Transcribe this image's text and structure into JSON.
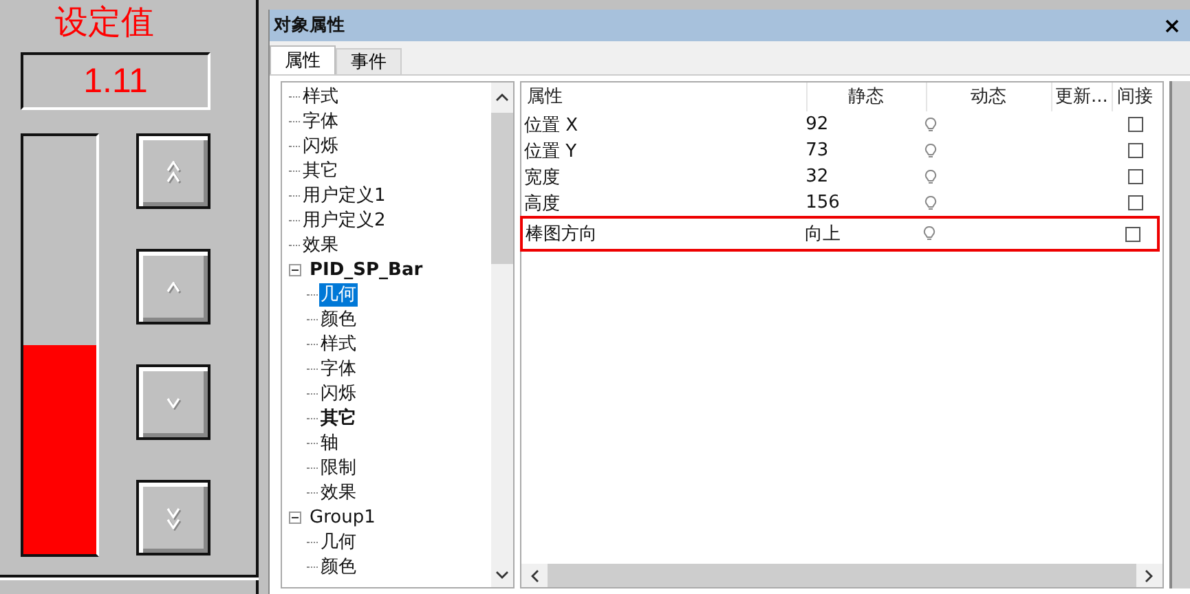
{
  "faceplate": {
    "title": "设定值",
    "value": "1.11",
    "bar": {
      "level": 0.5
    },
    "buttons": [
      {
        "kind": "fast-up"
      },
      {
        "kind": "up"
      },
      {
        "kind": "down"
      },
      {
        "kind": "fast-down"
      }
    ]
  },
  "window": {
    "title": "对象属性"
  },
  "tabs": [
    {
      "label": "属性",
      "selected": true
    },
    {
      "label": "事件",
      "selected": false
    }
  ],
  "tree": {
    "continued": [
      {
        "label": "样式",
        "bold": false,
        "selected": false
      },
      {
        "label": "字体",
        "bold": false,
        "selected": false
      },
      {
        "label": "闪烁",
        "bold": false,
        "selected": false
      },
      {
        "label": "其它",
        "bold": false,
        "selected": false
      },
      {
        "label": "用户定义1",
        "bold": false,
        "selected": false
      },
      {
        "label": "用户定义2",
        "bold": false,
        "selected": false
      },
      {
        "label": "效果",
        "bold": false,
        "selected": false
      }
    ],
    "nodes": [
      {
        "label": "PID_SP_Bar",
        "bold": true,
        "expanded": true,
        "children": [
          {
            "label": "几何",
            "bold": false,
            "selected": true
          },
          {
            "label": "颜色",
            "bold": false,
            "selected": false
          },
          {
            "label": "样式",
            "bold": false,
            "selected": false
          },
          {
            "label": "字体",
            "bold": false,
            "selected": false
          },
          {
            "label": "闪烁",
            "bold": false,
            "selected": false
          },
          {
            "label": "其它",
            "bold": true,
            "selected": false
          },
          {
            "label": "轴",
            "bold": false,
            "selected": false
          },
          {
            "label": "限制",
            "bold": false,
            "selected": false
          },
          {
            "label": "效果",
            "bold": false,
            "selected": false
          }
        ]
      },
      {
        "label": "Group1",
        "bold": false,
        "expanded": true,
        "children": [
          {
            "label": "几何",
            "bold": false,
            "selected": false
          },
          {
            "label": "颜色",
            "bold": false,
            "selected": false
          }
        ]
      }
    ]
  },
  "table": {
    "columns": [
      "属性",
      "静态",
      "动态",
      "更新...",
      "间接"
    ],
    "rows": [
      {
        "name": "位置 X",
        "static": "92",
        "highlighted": false,
        "indirect": false
      },
      {
        "name": "位置 Y",
        "static": "73",
        "highlighted": false,
        "indirect": false
      },
      {
        "name": "宽度",
        "static": "32",
        "highlighted": false,
        "indirect": false
      },
      {
        "name": "高度",
        "static": "156",
        "highlighted": false,
        "indirect": false
      },
      {
        "name": "棒图方向",
        "static": "向上",
        "highlighted": true,
        "indirect": false
      }
    ]
  }
}
